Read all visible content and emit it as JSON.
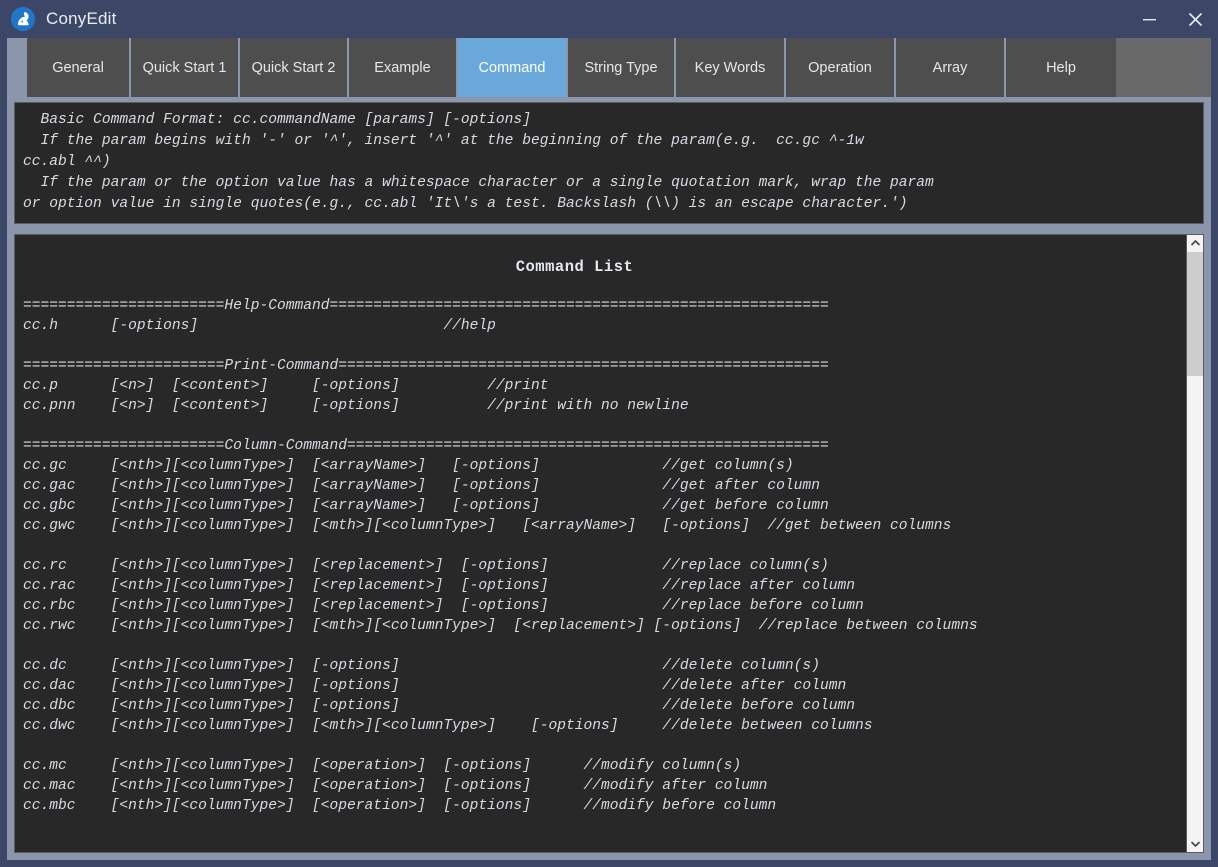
{
  "window": {
    "title": "ConyEdit",
    "logo_icon": "cony-rabbit-logo-icon",
    "minimize_label": "─",
    "close_label": "✕"
  },
  "tabs": [
    {
      "label": "General",
      "active": false
    },
    {
      "label": "Quick Start 1",
      "active": false
    },
    {
      "label": "Quick Start 2",
      "active": false
    },
    {
      "label": "Example",
      "active": false
    },
    {
      "label": "Command",
      "active": true
    },
    {
      "label": "String Type",
      "active": false
    },
    {
      "label": "Key Words",
      "active": false
    },
    {
      "label": "Operation",
      "active": false
    },
    {
      "label": "Array",
      "active": false
    },
    {
      "label": "Help",
      "active": false
    }
  ],
  "format_box": {
    "text": "  Basic Command Format: cc.commandName [params] [-options]\n  If the param begins with '-' or '^', insert '^' at the beginning of the param(e.g.  cc.gc ^-1w\ncc.abl ^^)\n  If the param or the option value has a whitespace character or a single quotation mark, wrap the param\nor option value in single quotes(e.g., cc.abl 'It\\'s a test. Backslash (\\\\) is an escape character.')"
  },
  "command_list": {
    "title": "Command List",
    "text": "=======================Help-Command=========================================================\ncc.h      [-options]                            //help\n\n=======================Print-Command========================================================\ncc.p      [<n>]  [<content>]     [-options]          //print\ncc.pnn    [<n>]  [<content>]     [-options]          //print with no newline\n\n=======================Column-Command=======================================================\ncc.gc     [<nth>][<columnType>]  [<arrayName>]   [-options]              //get column(s)\ncc.gac    [<nth>][<columnType>]  [<arrayName>]   [-options]              //get after column\ncc.gbc    [<nth>][<columnType>]  [<arrayName>]   [-options]              //get before column\ncc.gwc    [<nth>][<columnType>]  [<mth>][<columnType>]   [<arrayName>]   [-options]  //get between columns\n\ncc.rc     [<nth>][<columnType>]  [<replacement>]  [-options]             //replace column(s)\ncc.rac    [<nth>][<columnType>]  [<replacement>]  [-options]             //replace after column\ncc.rbc    [<nth>][<columnType>]  [<replacement>]  [-options]             //replace before column\ncc.rwc    [<nth>][<columnType>]  [<mth>][<columnType>]  [<replacement>] [-options]  //replace between columns\n\ncc.dc     [<nth>][<columnType>]  [-options]                              //delete column(s)\ncc.dac    [<nth>][<columnType>]  [-options]                              //delete after column\ncc.dbc    [<nth>][<columnType>]  [-options]                              //delete before column\ncc.dwc    [<nth>][<columnType>]  [<mth>][<columnType>]    [-options]     //delete between columns\n\ncc.mc     [<nth>][<columnType>]  [<operation>]  [-options]      //modify column(s)\ncc.mac    [<nth>][<columnType>]  [<operation>]  [-options]      //modify after column\ncc.mbc    [<nth>][<columnType>]  [<operation>]  [-options]      //modify before column"
  },
  "scrollbar": {
    "up_icon": "chevron-up-icon",
    "down_icon": "chevron-down-icon"
  },
  "colors": {
    "window_frame": "#3c4768",
    "body_bg": "#8b95ab",
    "tab_bg": "#4e4e4e",
    "tab_active_bg": "#6aa8dc",
    "panel_bg": "#282828",
    "panel_text": "#d7dbe2"
  }
}
